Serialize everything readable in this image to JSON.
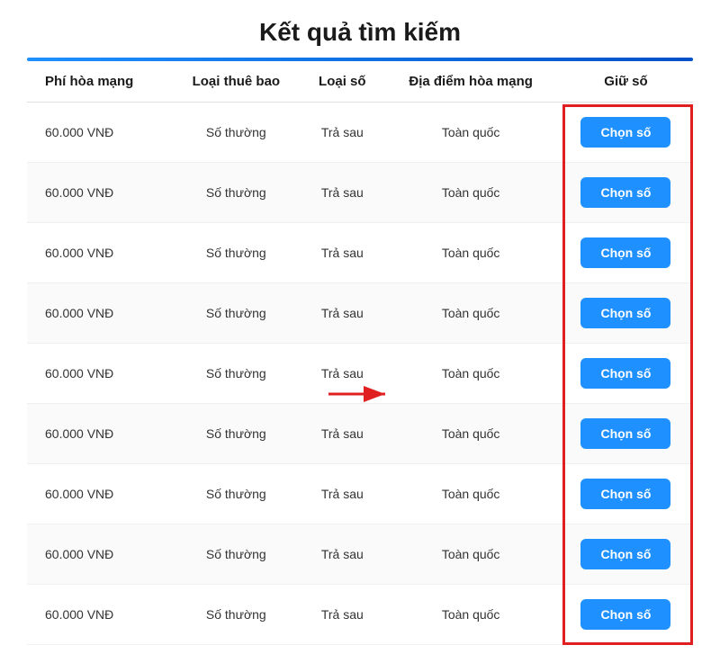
{
  "page": {
    "title": "Kết quả tìm kiếm"
  },
  "table": {
    "headers": {
      "phi_hoa_mang": "Phí hòa mạng",
      "loai_thue_bao": "Loại thuê bao",
      "loai_so": "Loại số",
      "dia_diem": "Địa điểm hòa mạng",
      "giu_so": "Giữ số"
    },
    "rows": [
      {
        "phi": "60.000 VNĐ",
        "loai_thue_bao": "Số thường",
        "loai_so": "Trả sau",
        "dia_diem": "Toàn quốc",
        "btn": "Chọn số"
      },
      {
        "phi": "60.000 VNĐ",
        "loai_thue_bao": "Số thường",
        "loai_so": "Trả sau",
        "dia_diem": "Toàn quốc",
        "btn": "Chọn số"
      },
      {
        "phi": "60.000 VNĐ",
        "loai_thue_bao": "Số thường",
        "loai_so": "Trả sau",
        "dia_diem": "Toàn quốc",
        "btn": "Chọn số"
      },
      {
        "phi": "60.000 VNĐ",
        "loai_thue_bao": "Số thường",
        "loai_so": "Trả sau",
        "dia_diem": "Toàn quốc",
        "btn": "Chọn số"
      },
      {
        "phi": "60.000 VNĐ",
        "loai_thue_bao": "Số thường",
        "loai_so": "Trả sau",
        "dia_diem": "Toàn quốc",
        "btn": "Chọn số"
      },
      {
        "phi": "60.000 VNĐ",
        "loai_thue_bao": "Số thường",
        "loai_so": "Trả sau",
        "dia_diem": "Toàn quốc",
        "btn": "Chọn số"
      },
      {
        "phi": "60.000 VNĐ",
        "loai_thue_bao": "Số thường",
        "loai_so": "Trả sau",
        "dia_diem": "Toàn quốc",
        "btn": "Chọn số"
      },
      {
        "phi": "60.000 VNĐ",
        "loai_thue_bao": "Số thường",
        "loai_so": "Trả sau",
        "dia_diem": "Toàn quốc",
        "btn": "Chọn số"
      },
      {
        "phi": "60.000 VNĐ",
        "loai_thue_bao": "Số thường",
        "loai_so": "Trả sau",
        "dia_diem": "Toàn quốc",
        "btn": "Chọn số"
      }
    ]
  },
  "colors": {
    "button_bg": "#1e90ff",
    "title_color": "#1a1a1a",
    "border_highlight": "#e02020"
  }
}
